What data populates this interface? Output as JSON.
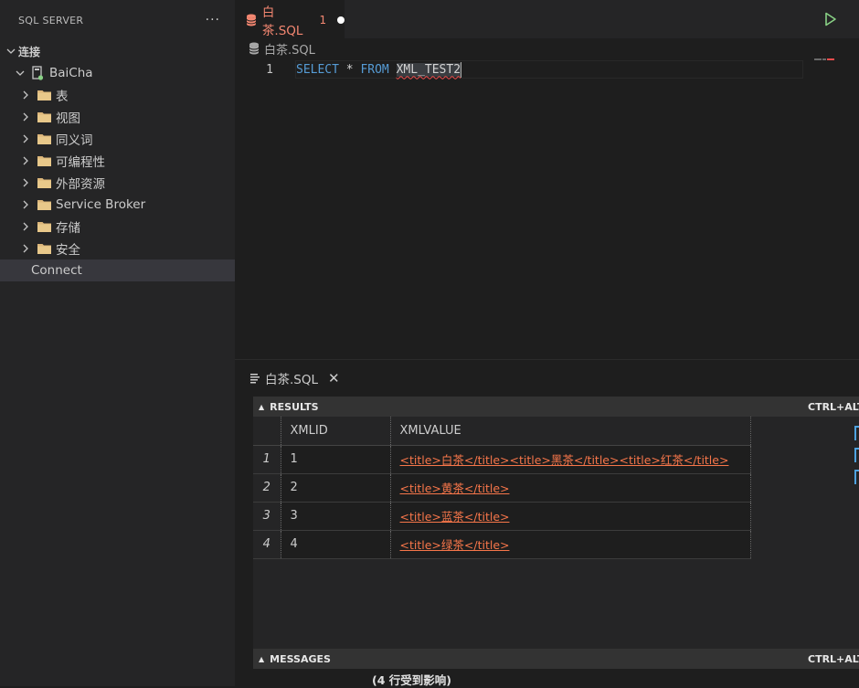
{
  "sidebar": {
    "title": "SQL SERVER",
    "more": "···",
    "section": "连接",
    "server": "BaiCha",
    "folders": [
      {
        "label": "表"
      },
      {
        "label": "视图"
      },
      {
        "label": "同义词"
      },
      {
        "label": "可编程性"
      },
      {
        "label": "外部资源"
      },
      {
        "label": "Service Broker"
      },
      {
        "label": "存储"
      },
      {
        "label": "安全"
      }
    ],
    "connect": "Connect"
  },
  "editor": {
    "tab": {
      "label": "白茶.SQL",
      "problems": "1"
    },
    "breadcrumb": "白茶.SQL",
    "line_number": "1",
    "code": {
      "kw1": "SELECT",
      "star": "*",
      "kw2": "FROM",
      "table": "XML_TEST2"
    }
  },
  "results": {
    "tab_label": "白茶.SQL",
    "close": "✕",
    "results_header": "RESULTS",
    "results_shortcut": "CTRL+ALT+R",
    "messages_header": "MESSAGES",
    "messages_shortcut": "CTRL+ALT+Y",
    "columns": [
      "XMLID",
      "XMLVALUE"
    ],
    "rows": [
      {
        "n": "1",
        "id": "1",
        "value": "<title>白茶</title><title>黑茶</title><title>红茶</title>"
      },
      {
        "n": "2",
        "id": "2",
        "value": "<title>黄茶</title>"
      },
      {
        "n": "3",
        "id": "3",
        "value": "<title>蓝茶</title>"
      },
      {
        "n": "4",
        "id": "4",
        "value": "<title>绿茶</title>"
      }
    ],
    "message": "(4 行受到影响)"
  },
  "colors": {
    "accent_tab": "#f48771",
    "link": "#f7764a",
    "keyword": "#569cd6",
    "run": "#89d185"
  }
}
